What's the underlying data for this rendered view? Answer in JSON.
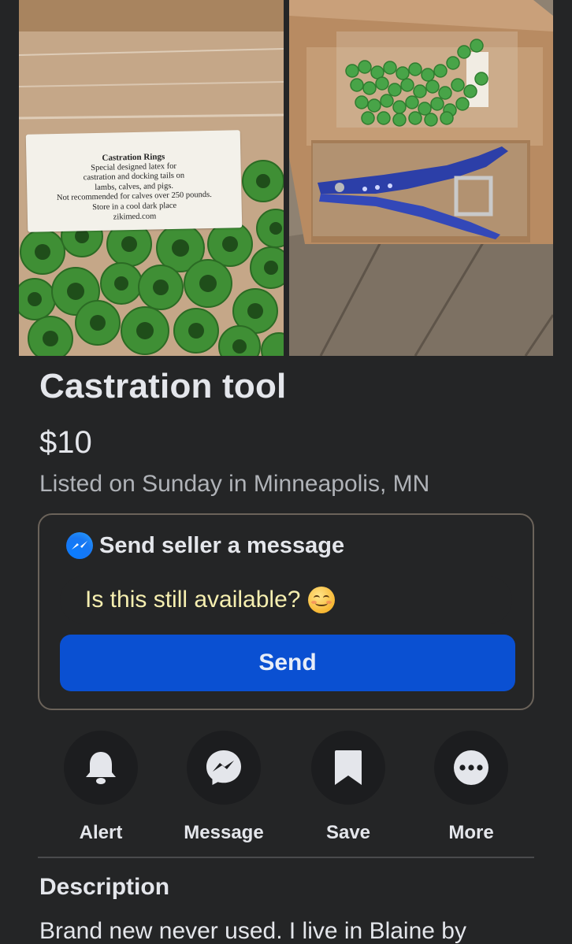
{
  "listing": {
    "title": "Castration tool",
    "price": "$10",
    "listed": "Listed on Sunday in Minneapolis, MN"
  },
  "photos": {
    "left_label": {
      "title": "Castration Rings",
      "line1": "Special designed latex for",
      "line2": "castration and docking tails on",
      "line3": "lambs, calves, and pigs.",
      "line4": "Not recommended for calves over 250 pounds.",
      "line5": "Store in a cool dark place",
      "line6": "zikimed.com"
    }
  },
  "message_card": {
    "header": "Send seller a message",
    "header_icon": "messenger-icon",
    "input_value": "Is this still available?",
    "send_label": "Send",
    "accent": "#0a50d2"
  },
  "actions": [
    {
      "label": "Alert",
      "icon": "bell-icon"
    },
    {
      "label": "Message",
      "icon": "messenger-icon"
    },
    {
      "label": "Save",
      "icon": "bookmark-icon"
    },
    {
      "label": "More",
      "icon": "more-icon"
    }
  ],
  "description": {
    "heading": "Description",
    "body": "Brand new never used. I live in Blaine by"
  }
}
